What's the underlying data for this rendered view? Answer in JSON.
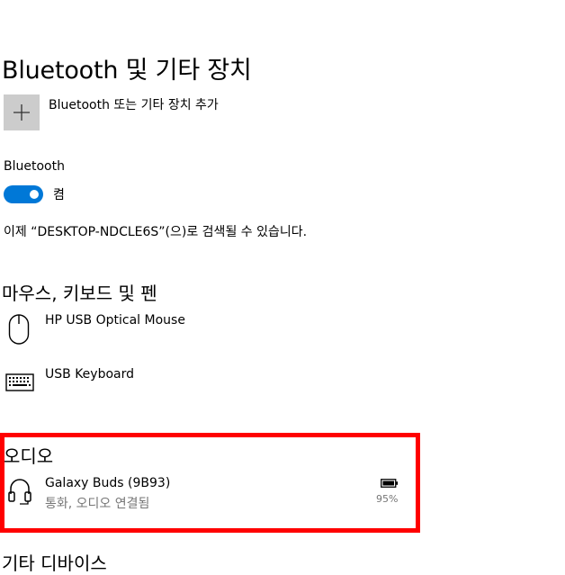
{
  "header": {
    "title": "Bluetooth 및 기타 장치"
  },
  "add_device": {
    "label": "Bluetooth 또는 기타 장치 추가",
    "icon": "plus-icon"
  },
  "bluetooth": {
    "label": "Bluetooth",
    "toggle_on": true,
    "state_label": "켬",
    "accent_color": "#0078d7",
    "discoverable_text": "이제 “DESKTOP-NDCLE6S”(으)로 검색될 수 있습니다."
  },
  "sections": {
    "input": {
      "title": "마우스, 키보드 및 펜",
      "devices": [
        {
          "name": "HP USB Optical Mouse",
          "icon": "mouse-icon"
        },
        {
          "name": "USB Keyboard",
          "icon": "keyboard-icon"
        }
      ]
    },
    "audio": {
      "title": "오디오",
      "devices": [
        {
          "name": "Galaxy Buds (9B93)",
          "status": "통화, 오디오 연결됨",
          "battery": "95%",
          "icon": "headset-icon"
        }
      ]
    },
    "other": {
      "title": "기타 디바이스"
    }
  },
  "highlight_color": "#ff0000"
}
